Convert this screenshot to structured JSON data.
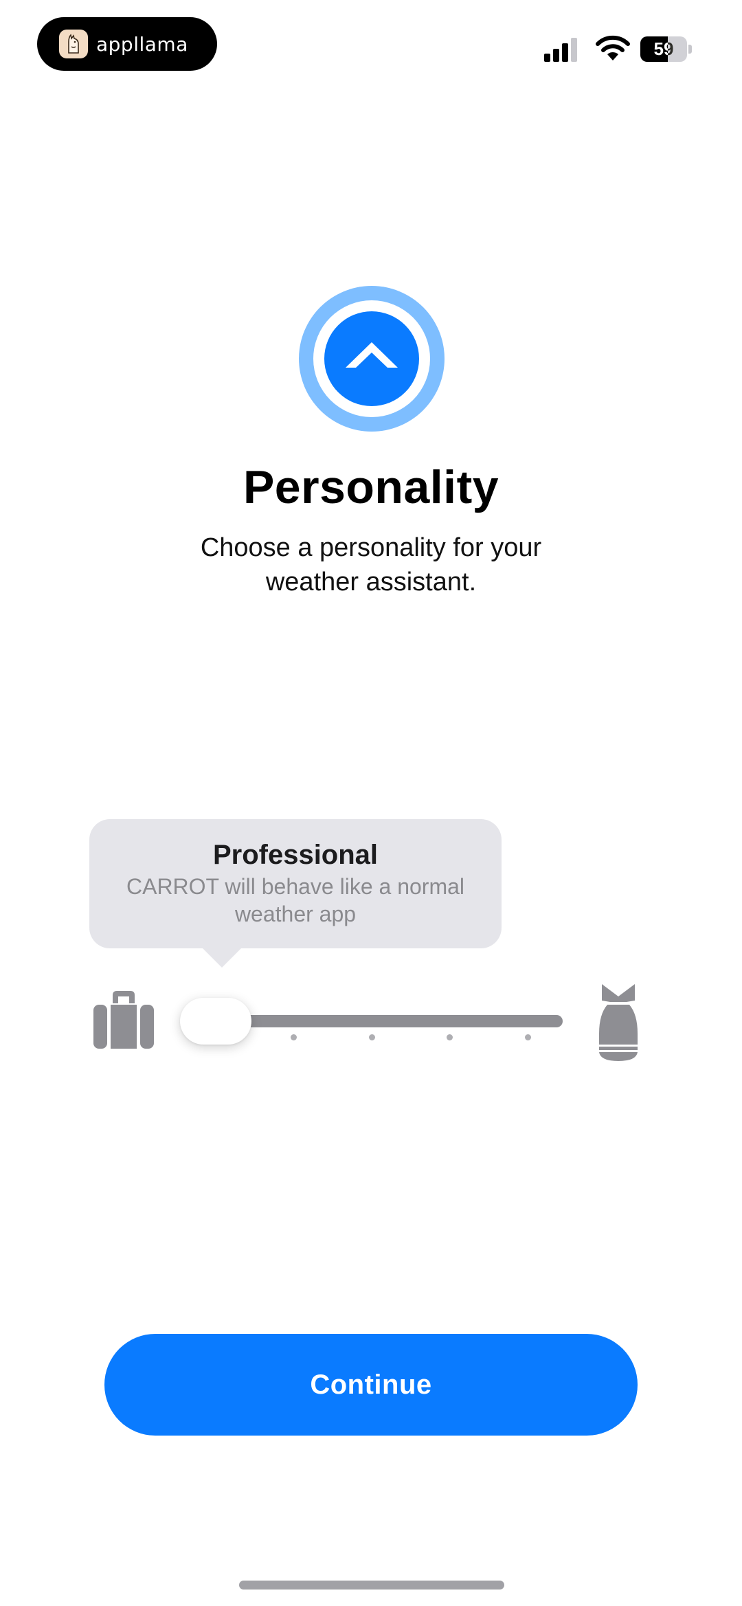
{
  "status_bar": {
    "brand_name": "appllama",
    "battery_level": 59,
    "battery_label": "59"
  },
  "header": {
    "title": "Personality",
    "subtitle": "Choose a personality for your weather assistant."
  },
  "personality_slider": {
    "steps": 5,
    "selected_index": 0,
    "min_icon": "suitcase-icon",
    "max_icon": "bomb-icon",
    "tooltip": {
      "title": "Professional",
      "description": "CARROT will behave like a normal weather app"
    }
  },
  "actions": {
    "continue_label": "Continue"
  },
  "colors": {
    "accent": "#0A7BFF",
    "accent_ring": "#7EBEFF",
    "track": "#8E8E93",
    "tooltip_bg": "#E5E5EA"
  }
}
